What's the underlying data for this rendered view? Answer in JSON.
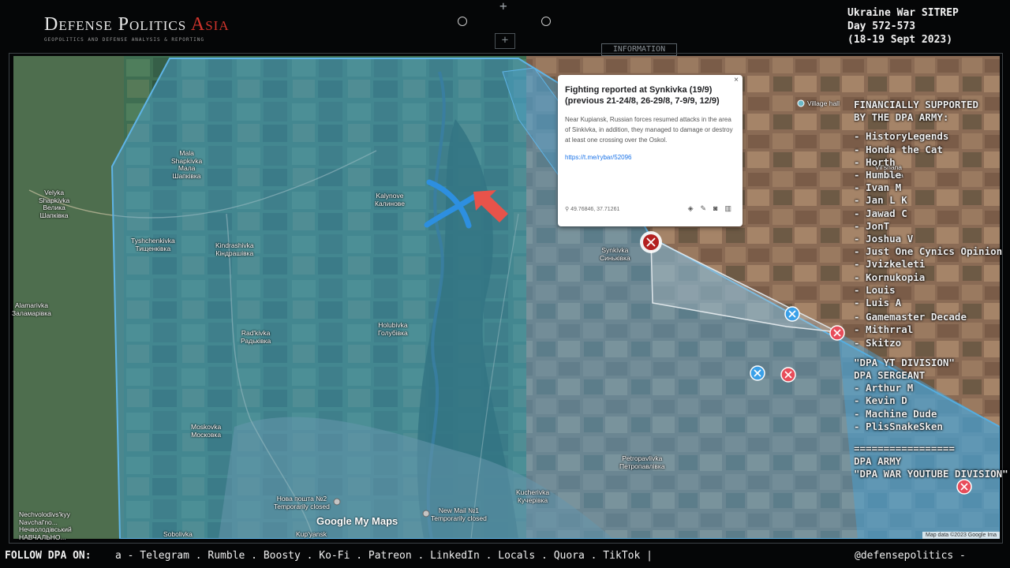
{
  "header": {
    "brand_main": "Defense Politics",
    "brand_accent": "Asia",
    "tagline": "GEOPOLITICS AND DEFENSE ANALYSIS & REPORTING",
    "sitrep": [
      "Ukraine War SITREP",
      "Day 572-573",
      "(18-19 Sept 2023)"
    ],
    "info_tab": "INFORMATION"
  },
  "colors": {
    "control_fill": "#4aa3d6",
    "russian_attack": "#e8534a",
    "ukrainian_marker": "#2d8fe0",
    "marker_red": "#e84d5a",
    "marker_blue": "#3aa0e8"
  },
  "map": {
    "places": [
      {
        "name": "Mala\nShapkivka\nМала\nШапківка"
      },
      {
        "name": "Velyka\nShapkivka\nВелика\nШапківка"
      },
      {
        "name": "Kalynove\nКалинове"
      },
      {
        "name": "Tyshchenkivka\nТищенківка"
      },
      {
        "name": "Kindrashivka\nКіндрашівка"
      },
      {
        "name": "Synkivka\nСиньківка"
      },
      {
        "name": "Alamarivka\nЗаламарівка"
      },
      {
        "name": "Rad'kivka\nРадьківка"
      },
      {
        "name": "Holubivka\nГолубівка"
      },
      {
        "name": "Moskovka\nМосковка"
      },
      {
        "name": "Petropavlivka\nПетропавлівка"
      },
      {
        "name": "Kuchеrivka\nКучерівка"
      },
      {
        "name": "Nechvolodivs'kyy\nNavchal'no...\nНечволодівський\nНАВЧАЛЬНО..."
      },
      {
        "name": "Нова пошта №2\nTemporarily closed"
      },
      {
        "name": "New Mail №1\nTemporarily closed"
      },
      {
        "name": "Village hall"
      },
      {
        "name": "Vil'shana\nВільшана"
      },
      {
        "name": "Kup'yansk"
      },
      {
        "name": "Sobolivka"
      }
    ],
    "google_logo": "Google My Maps",
    "attribution": "Map data ©2023 Google Ima"
  },
  "popup": {
    "title": "Fighting reported at Synkivka (19/9) (previous 21-24/8, 26-29/8, 7-9/9, 12/9)",
    "body": "Near Kupiansk, Russian forces resumed attacks in the area of Sinkivka, in addition, they managed to damage or destroy at least one crossing over the Oskol.",
    "link": "https://t.me/rybar/52096",
    "coords": "49.76846, 37.71261",
    "close": "×"
  },
  "supporters": {
    "heading": [
      "FINANCIALLY SUPPORTED",
      "BY THE DPA ARMY:"
    ],
    "group1": [
      "- HistoryLegends",
      "- Honda the Cat",
      "- Horth",
      "- Humble",
      "- Ivan M",
      "- Jan L K",
      "- Jawad C",
      "- JonT",
      "- Joshua V",
      "- Just One Cynics Opinion",
      "- Jvizkeleti",
      "- Kornukopia",
      "- Louis",
      "- Luis A"
    ],
    "group2": [
      "- Gamemaster Decade",
      "- Mithrral",
      "- Skitzo"
    ],
    "yt_heading": [
      "\"DPA YT DIVISION\"",
      "DPA SERGEANT"
    ],
    "group3": [
      "- Arthur M",
      "- Kevin D",
      "- Machine Dude",
      "- PlisSnakeSken"
    ],
    "divider": "=================",
    "tail": [
      "DPA ARMY",
      "\"DPA WAR YOUTUBE DIVISION\""
    ]
  },
  "footer": {
    "lead": "FOLLOW DPA ON:",
    "platforms": "a  -  Telegram . Rumble . Boosty . Ko-Fi . Patreon . LinkedIn . Locals . Quora . TikTok   |",
    "handle": "@defensepolitics  -"
  }
}
